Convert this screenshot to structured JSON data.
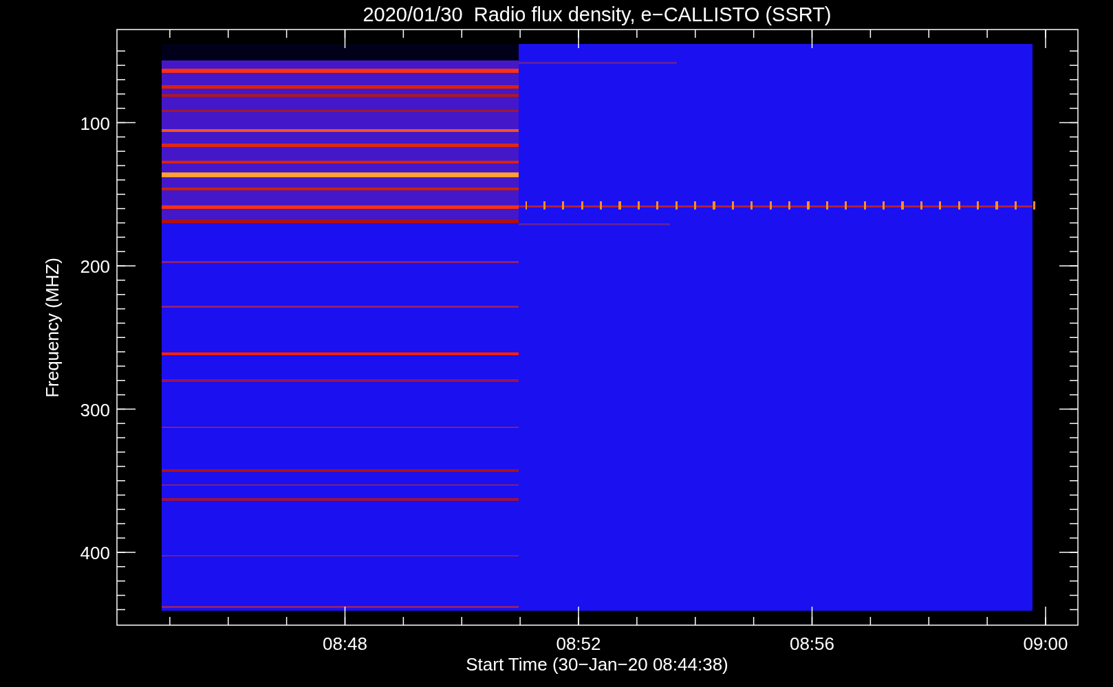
{
  "title": "2020/01/30  Radio flux density, e−CALLISTO (SSRT)",
  "ylabel": "Frequency (MHZ)",
  "xlabel": "Start Time (30−Jan−20 08:44:38)",
  "yticks": [
    "100",
    "200",
    "300",
    "400"
  ],
  "xticks": [
    "08:48",
    "08:52",
    "08:56",
    "09:00"
  ]
}
